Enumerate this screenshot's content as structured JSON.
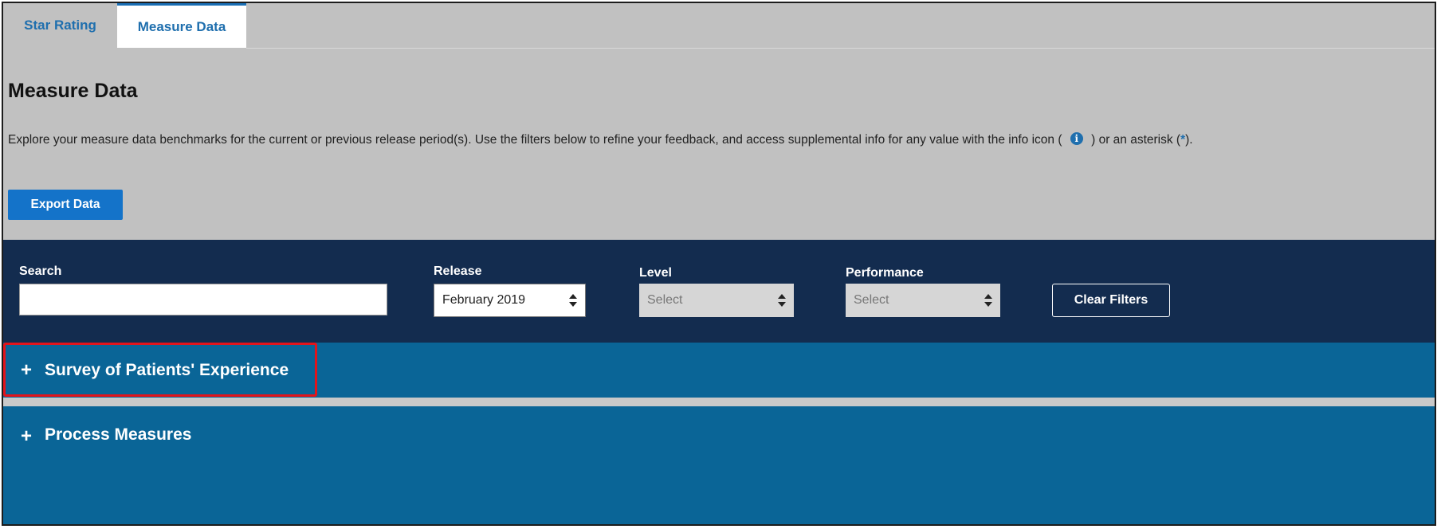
{
  "tabs": [
    {
      "label": "Star Rating"
    },
    {
      "label": "Measure Data"
    }
  ],
  "header": {
    "title": "Measure Data",
    "intro_before_icon": "Explore your measure data benchmarks for the current or previous release period(s). Use the filters below to refine your feedback, and access supplemental info for any value with the info icon (",
    "info_icon_glyph": "i",
    "intro_after_icon": ") or an asterisk (",
    "asterisk": "*",
    "intro_end": ")."
  },
  "export_button": {
    "label": "Export Data"
  },
  "filters": {
    "search": {
      "label": "Search",
      "value": ""
    },
    "release": {
      "label": "Release",
      "value": "February 2019"
    },
    "level": {
      "label": "Level",
      "value": "Select"
    },
    "performance": {
      "label": "Performance",
      "value": "Select"
    },
    "clear_label": "Clear Filters"
  },
  "sections": [
    {
      "icon": "+",
      "label": "Survey of Patients' Experience",
      "highlighted": true
    },
    {
      "icon": "+",
      "label": "Process Measures"
    }
  ],
  "colors": {
    "filter_bar": "#132c4f",
    "accordion": "#0a6597",
    "accent": "#1473c9",
    "highlight": "#e3141b"
  }
}
